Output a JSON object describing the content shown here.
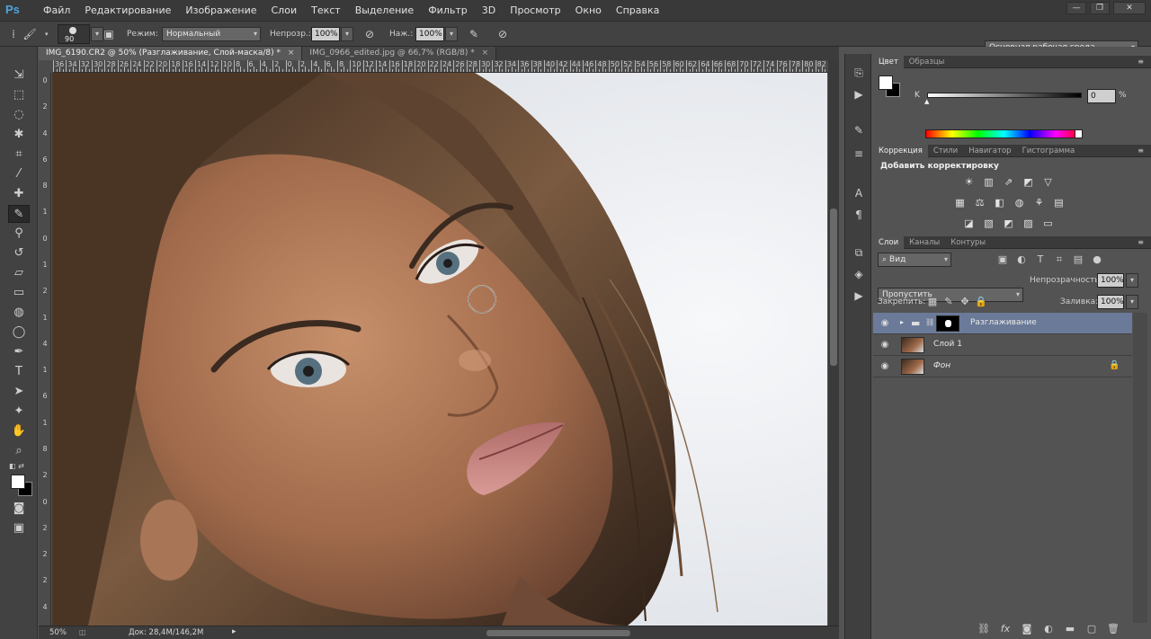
{
  "app": {
    "logo": "Ps"
  },
  "menu": [
    "Файл",
    "Редактирование",
    "Изображение",
    "Слои",
    "Текст",
    "Выделение",
    "Фильтр",
    "3D",
    "Просмотр",
    "Окно",
    "Справка"
  ],
  "window_controls": {
    "minimize": "—",
    "restore": "❐",
    "close": "✕"
  },
  "options": {
    "brush_size": "90",
    "mode_label": "Режим:",
    "mode_value": "Нормальный",
    "opacity_label": "Непрозр.:",
    "opacity_value": "100%",
    "pressure_label": "Наж.:",
    "pressure_value": "100%",
    "workspace": "Основная рабочая среда"
  },
  "documents": [
    {
      "title": "IMG_6190.CR2 @ 50% (Разглаживание, Слой-маска/8) *",
      "active": true
    },
    {
      "title": "IMG_0966_edited.jpg @ 66,7% (RGB/8) *",
      "active": false
    }
  ],
  "ruler": {
    "h": [
      "36",
      "34",
      "32",
      "30",
      "28",
      "26",
      "24",
      "22",
      "20",
      "18",
      "16",
      "14",
      "12",
      "10",
      "8",
      "6",
      "4",
      "2",
      "0",
      "2",
      "4",
      "6",
      "8",
      "10",
      "12",
      "14",
      "16",
      "18",
      "20",
      "22",
      "24",
      "26",
      "28",
      "30",
      "32",
      "34",
      "36",
      "38",
      "40",
      "42",
      "44",
      "46",
      "48",
      "50",
      "52",
      "54",
      "56",
      "58",
      "60",
      "62",
      "64",
      "66",
      "68",
      "70",
      "72",
      "74",
      "76",
      "78",
      "80",
      "82"
    ],
    "v": [
      "0",
      "2",
      "4",
      "6",
      "8",
      "1",
      "0",
      "1",
      "2",
      "1",
      "4",
      "1",
      "6",
      "1",
      "8",
      "2",
      "0",
      "2",
      "2",
      "2",
      "4"
    ]
  },
  "status": {
    "zoom": "50%",
    "doc": "Док: 28,4M/146,2M"
  },
  "color_panel": {
    "tabs": [
      "Цвет",
      "Образцы"
    ],
    "slider_label": "K",
    "value": "0",
    "unit": "%"
  },
  "adjustments_panel": {
    "tabs": [
      "Коррекция",
      "Стили",
      "Навигатор",
      "Гистограмма"
    ],
    "heading": "Добавить корректировку",
    "row1": [
      "☀",
      "▥",
      "⇗",
      "◩",
      "▽"
    ],
    "row2": [
      "▦",
      "⚖",
      "◧",
      "◍",
      "⚘",
      "▤"
    ],
    "row3": [
      "◪",
      "▧",
      "◩",
      "▨",
      "▭"
    ]
  },
  "layers_panel": {
    "tabs": [
      "Слои",
      "Каналы",
      "Контуры"
    ],
    "filter_label": "Вид",
    "blend_mode": "Пропустить",
    "opacity_label": "Непрозрачность:",
    "opacity_value": "100%",
    "lock_label": "Закрепить:",
    "fill_label": "Заливка:",
    "fill_value": "100%",
    "layers": [
      {
        "name": "Разглаживание",
        "type": "group",
        "selected": true
      },
      {
        "name": "Слой 1",
        "type": "pixel",
        "selected": false
      },
      {
        "name": "Фон",
        "type": "background",
        "selected": false,
        "locked": true
      }
    ],
    "bottom_icons": [
      "link-icon",
      "fx-icon",
      "mask-icon",
      "adjustment-icon",
      "folder-icon",
      "new-layer-icon",
      "trash-icon"
    ]
  },
  "colors": {
    "accent": "#4fa3e0",
    "selected_layer": "#6b7a99",
    "panel": "#535353"
  }
}
